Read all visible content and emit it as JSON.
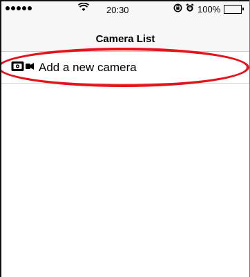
{
  "status_bar": {
    "time": "20:30",
    "battery": "100%"
  },
  "nav": {
    "title": "Camera List"
  },
  "list": {
    "items": [
      {
        "label": "Add a new camera",
        "icon": "video-camera-icon"
      }
    ]
  },
  "colors": {
    "annotation": "#e4141a",
    "nav_bg": "#f7f7f7"
  }
}
